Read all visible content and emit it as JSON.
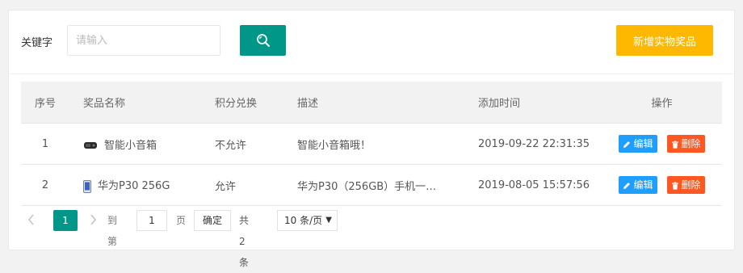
{
  "search": {
    "label": "关键字",
    "placeholder": "请输入",
    "button_icon": "search-icon"
  },
  "add_button": {
    "label": "新增实物奖品"
  },
  "colors": {
    "primary": "#009688",
    "warning": "#ffb800",
    "edit": "#1e9fff",
    "delete": "#ff5722"
  },
  "table": {
    "headers": {
      "no": "序号",
      "name": "奖品名称",
      "points": "积分兑换",
      "desc": "描述",
      "time": "添加时间",
      "ops": "操作"
    },
    "rows": [
      {
        "no": "1",
        "icon": "speaker-icon",
        "name": "智能小音箱",
        "points": "不允许",
        "desc": "智能小音箱哦！",
        "time": "2019-09-22 22:31:35"
      },
      {
        "no": "2",
        "icon": "phone-icon",
        "name": "华为P30 256G",
        "points": "允许",
        "desc": "华为P30（256GB）手机一…",
        "time": "2019-08-05 15:57:56"
      }
    ],
    "edit_label": "编辑",
    "delete_label": "删除"
  },
  "pagination": {
    "current_page": "1",
    "goto_label": "到第",
    "goto_value": "1",
    "page_label": "页",
    "confirm_label": "确定",
    "total_label": "共 2 条",
    "page_size": "10 条/页"
  }
}
